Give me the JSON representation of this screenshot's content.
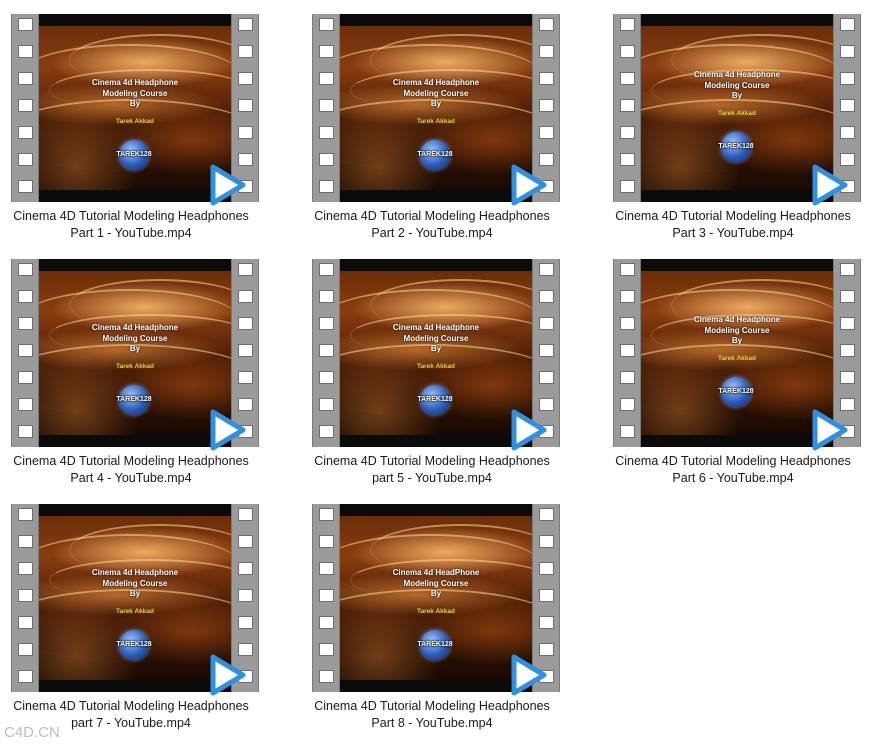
{
  "files": [
    {
      "line1": "Cinema 4D Tutorial Modeling Headphones",
      "line2": "Part 1 - YouTube.mp4",
      "title1": "Cinema 4d Headphone",
      "title2": "Modeling Course",
      "title3": "By",
      "author": "Tarek Akkad",
      "logo": "TAREK128"
    },
    {
      "line1": "Cinema 4D Tutorial Modeling Headphones",
      "line2": "Part 2 - YouTube.mp4",
      "title1": "Cinema 4d Headphone",
      "title2": "Modeling Course",
      "title3": "By",
      "author": "Tarek Akkad",
      "logo": "TAREK128"
    },
    {
      "line1": "Cinema 4D Tutorial Modeling Headphones",
      "line2": "Part 3 - YouTube.mp4",
      "title1": "Cinema 4d Headphone",
      "title2": "Modeling Course",
      "title3": "By",
      "author": "Tarek Akkad",
      "logo": "TAREK128"
    },
    {
      "line1": "Cinema 4D Tutorial Modeling Headphones",
      "line2": "Part 4 - YouTube.mp4",
      "title1": "Cinema 4d Headphone",
      "title2": "Modeling Course",
      "title3": "By",
      "author": "Tarek Akkad",
      "logo": "TAREK128"
    },
    {
      "line1": "Cinema 4D Tutorial Modeling Headphones",
      "line2": "part 5 - YouTube.mp4",
      "title1": "Cinema 4d Headphone",
      "title2": "Modeling Course",
      "title3": "By",
      "author": "Tarek Akkad",
      "logo": "TAREK128"
    },
    {
      "line1": "Cinema 4D Tutorial Modeling Headphones",
      "line2": "Part 6 - YouTube.mp4",
      "title1": "Cinema 4d Headphone",
      "title2": "Modeling Course",
      "title3": "By",
      "author": "Tarek Akkad",
      "logo": "TAREK128"
    },
    {
      "line1": "Cinema 4D Tutorial Modeling Headphones",
      "line2": "part 7 - YouTube.mp4",
      "title1": "Cinema 4d Headphone",
      "title2": "Modeling Course",
      "title3": "By",
      "author": "Tarek Akkad",
      "logo": "TAREK128"
    },
    {
      "line1": "Cinema 4D Tutorial Modeling Headphones",
      "line2": "Part 8 - YouTube.mp4",
      "title1": "Cinema 4d HeadPhone",
      "title2": "Modeling Course",
      "title3": "By",
      "author": "Tarek Akkad",
      "logo": "TAREK128"
    }
  ],
  "watermark": "C4D.CN",
  "colors": {
    "play_icon": "#2f8fe0",
    "film_strip": "#9a9a9a",
    "author_text": "#e3d23c"
  }
}
